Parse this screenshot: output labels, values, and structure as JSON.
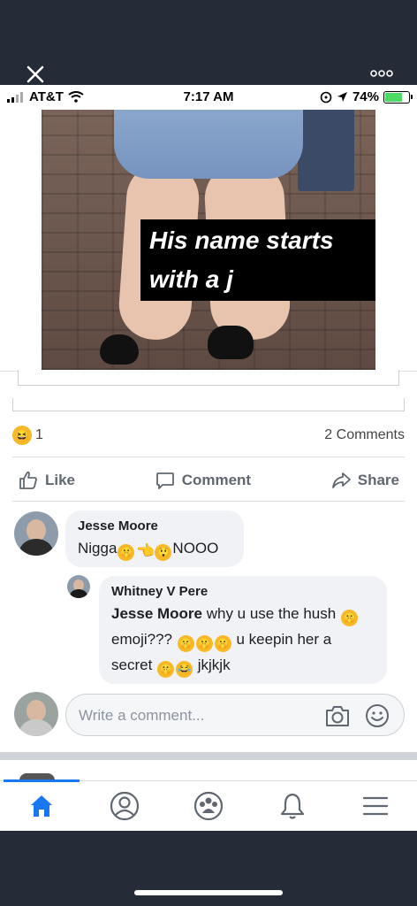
{
  "viewer": {
    "close_icon": "close-icon",
    "more_icon": "more-icon"
  },
  "statusbar": {
    "carrier": "AT&T",
    "time": "7:17 AM",
    "battery": "74%"
  },
  "photo": {
    "caption_line1": "His name starts",
    "caption_line2": "with a j"
  },
  "post": {
    "reaction_count": "1",
    "reaction_icon": "haha-react-icon",
    "comment_count": "2 Comments",
    "actions": {
      "like": "Like",
      "comment": "Comment",
      "share": "Share"
    }
  },
  "comments": [
    {
      "author": "Jesse Moore",
      "text_before": "Nigga",
      "text_after": "NOOO"
    },
    {
      "author": "Whitney V Pere",
      "mention": "Jesse Moore",
      "text_1": " why u use the hush ",
      "text_2": "emoji??? ",
      "text_3": " u keepin her a",
      "text_4": "secret ",
      "text_5": " jkjkjk"
    }
  ],
  "composer": {
    "placeholder": "Write a comment..."
  },
  "nav": {
    "items": [
      "home-icon",
      "profile-icon",
      "groups-icon",
      "notifications-icon",
      "menu-icon"
    ],
    "active_color": "#1877f2"
  }
}
